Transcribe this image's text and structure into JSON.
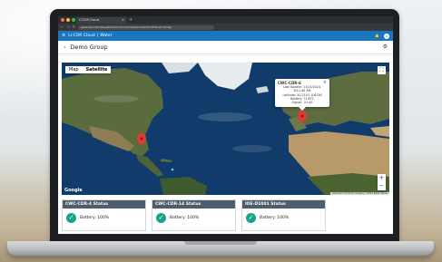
{
  "browser": {
    "tab_title": "CO2IR Cloud",
    "tab_close": "×",
    "new_tab": "+",
    "back": "←",
    "forward": "→",
    "reload": "↻",
    "url": "www.dev.remotesystemscloud.com/d/device/1234-5678-abcd/map"
  },
  "app": {
    "menu_glyph": "≡",
    "brand": "Li-COR Cloud",
    "section": "Water",
    "avatar": "A",
    "bell": "🔔"
  },
  "page": {
    "back_glyph": "‹",
    "title": "Demo Group",
    "settings_glyph": "⚙"
  },
  "map": {
    "type_options": [
      "Map",
      "Satellite"
    ],
    "selected_type": "Satellite",
    "fullscreen_glyph": "⛶",
    "zoom_in": "+",
    "zoom_out": "−",
    "google": "Google",
    "attribution": "Keyboard shortcuts  Imagery ©2024 NASA  Terms",
    "colors": {
      "ocean": "#103b6b",
      "land": "#5a6b3e",
      "desert": "#b89a6a",
      "ice": "#e7ecef",
      "pin": "#e53935"
    }
  },
  "popup": {
    "title": "CWC-CDR-6",
    "close": "×",
    "lines": [
      "Last Update: 11/15/2024, 8:11:40 AM",
      "Latitude: 50.2143, 8.6136",
      "Battery: 72.672",
      "Signal: -51.00"
    ]
  },
  "cards": [
    {
      "title": "CWC-CDR-4 Status",
      "battery": "Battery: 100%"
    },
    {
      "title": "CWC-CDR-14 Status",
      "battery": "Battery: 100%"
    },
    {
      "title": "IOE-D1001 Status",
      "battery": "Battery: 100%"
    }
  ],
  "icons": {
    "check": "✓",
    "status_color": "#17a589",
    "header_color": "#1b75bc"
  }
}
